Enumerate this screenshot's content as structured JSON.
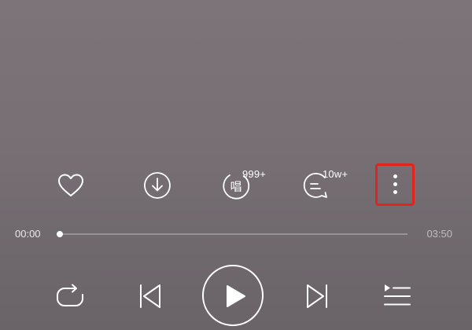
{
  "actions": {
    "like_icon": "heart-outline-icon",
    "download_icon": "download-circle-icon",
    "sing": {
      "icon": "sing-icon",
      "glyph": "唱",
      "count": "999+"
    },
    "comments": {
      "icon": "comment-bubble-icon",
      "count": "10w+"
    },
    "more_icon": "more-vertical-icon",
    "highlight_color": "#e3241d"
  },
  "progress": {
    "current_time": "00:00",
    "total_time": "03:50",
    "fraction": 0.0
  },
  "controls": {
    "repeat_icon": "repeat-icon",
    "previous_icon": "previous-track-icon",
    "play_icon": "play-icon",
    "next_icon": "next-track-icon",
    "playlist_icon": "playlist-icon"
  },
  "colors": {
    "foreground": "#ffffff",
    "background": "#776f74"
  }
}
